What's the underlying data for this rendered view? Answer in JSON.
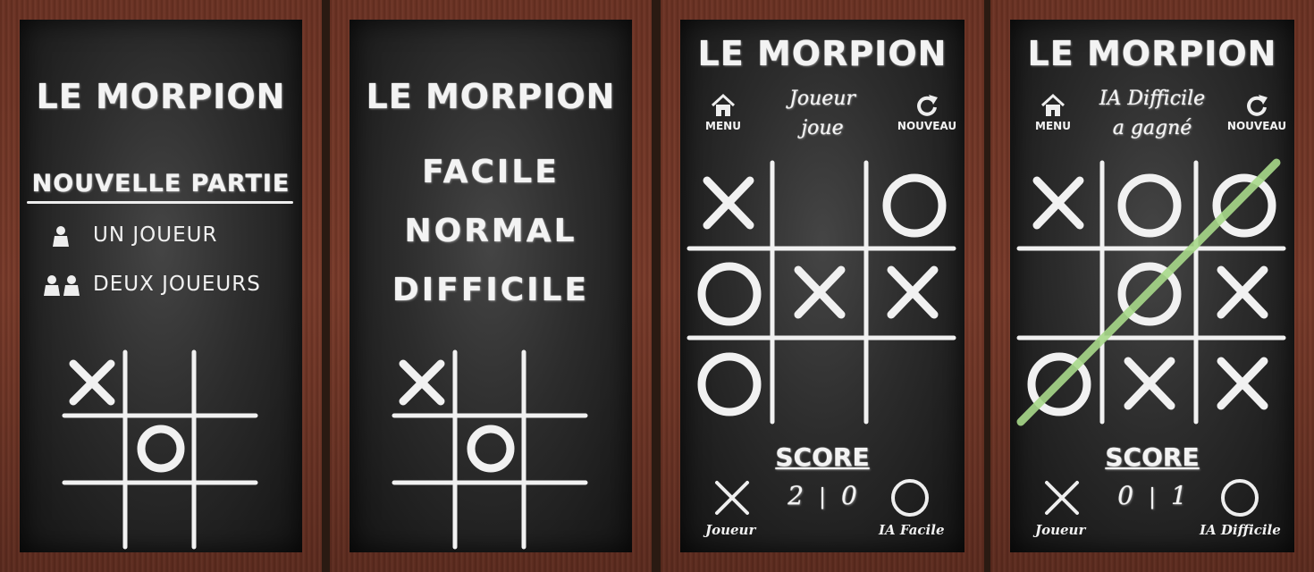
{
  "screens": [
    {
      "title": "LE MORPION",
      "menu": {
        "heading": "NOUVELLE PARTIE",
        "options": [
          {
            "label": "UN JOUEUR",
            "icon": "single-player-icon"
          },
          {
            "label": "DEUX JOUEURS",
            "icon": "two-players-icon"
          }
        ]
      }
    },
    {
      "title": "LE MORPION",
      "difficulties": [
        "FACILE",
        "NORMAL",
        "DIFFICILE"
      ]
    },
    {
      "title": "LE MORPION",
      "menu_button": "MENU",
      "new_button": "NOUVEAU",
      "status_line1": "Joueur",
      "status_line2": "joue",
      "board": [
        "X",
        "",
        "O",
        "O",
        "X",
        "X",
        "O",
        "",
        ""
      ],
      "score_title": "SCORE",
      "score_left": "2",
      "score_sep": "|",
      "score_right": "0",
      "player_left": "Joueur",
      "player_right": "IA Facile"
    },
    {
      "title": "LE MORPION",
      "menu_button": "MENU",
      "new_button": "NOUVEAU",
      "status_line1": "IA Difficile",
      "status_line2": "a gagné",
      "board": [
        "X",
        "O",
        "O",
        "",
        "O",
        "X",
        "O",
        "X",
        "X"
      ],
      "winning_line": "diagonal bottom-left to top-right",
      "score_title": "SCORE",
      "score_left": "0",
      "score_sep": "|",
      "score_right": "1",
      "player_left": "Joueur",
      "player_right": "IA Difficile"
    }
  ],
  "colors": {
    "chalk": "#f1f1f1",
    "win_line": "#a8d98a",
    "frame": "#6d3324",
    "board": "#2c2c2c"
  }
}
